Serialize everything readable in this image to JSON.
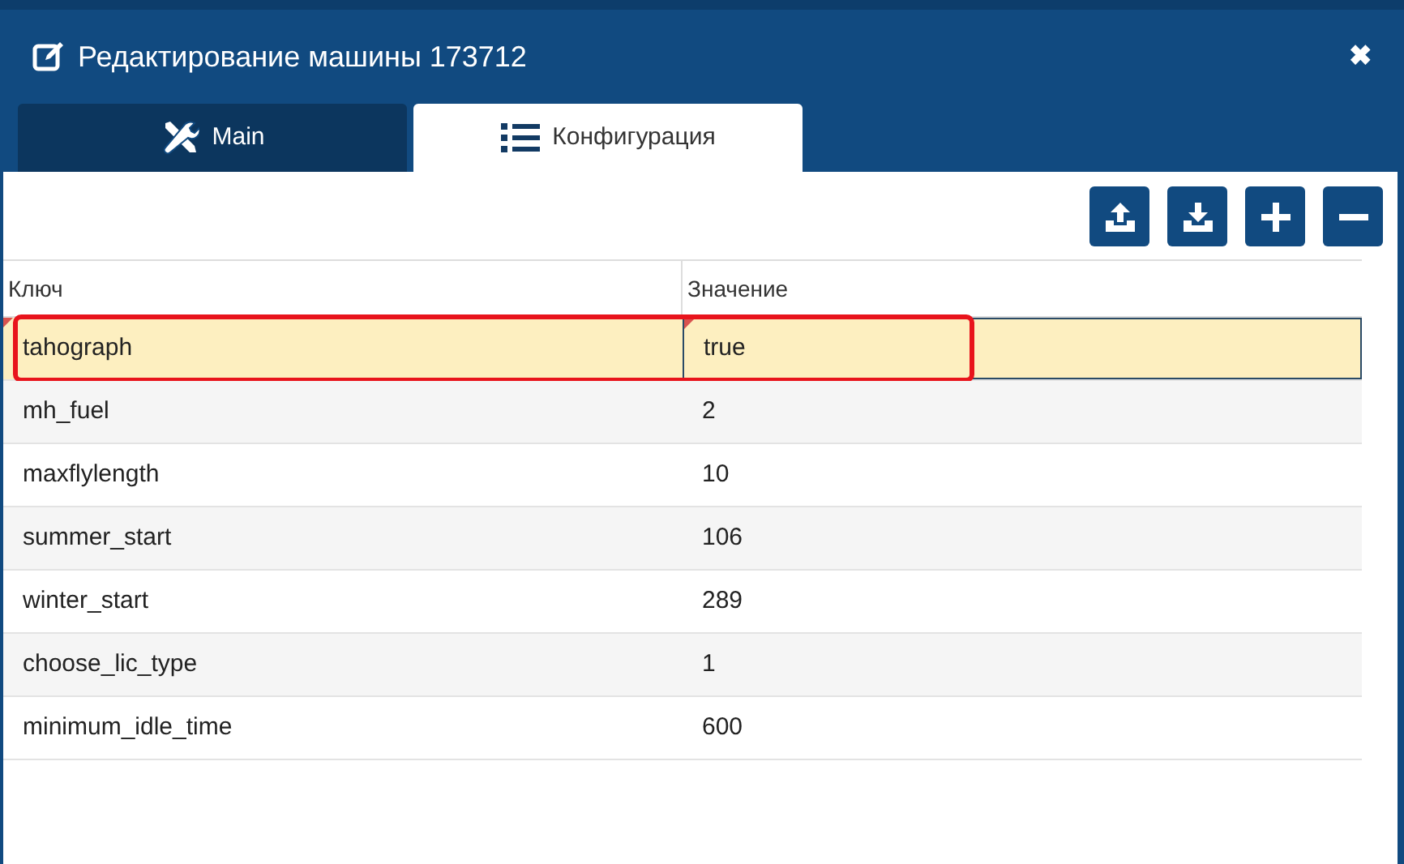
{
  "window": {
    "title": "Редактирование машины 173712",
    "close": "✖"
  },
  "tabs": [
    {
      "label": "Main",
      "selected": false
    },
    {
      "label": "Конфигурация",
      "selected": true
    }
  ],
  "table": {
    "columns": [
      "Ключ",
      "Значение"
    ],
    "rows": [
      {
        "key": "tahograph",
        "value": "true",
        "selected": true,
        "modified": true,
        "editing": true,
        "highlighted": true
      },
      {
        "key": "mh_fuel",
        "value": "2",
        "selected": false,
        "modified": false,
        "editing": false,
        "highlighted": false
      },
      {
        "key": "maxflylength",
        "value": "10",
        "selected": false,
        "modified": false,
        "editing": false,
        "highlighted": false
      },
      {
        "key": "summer_start",
        "value": "106",
        "selected": false,
        "modified": false,
        "editing": false,
        "highlighted": false
      },
      {
        "key": "winter_start",
        "value": "289",
        "selected": false,
        "modified": false,
        "editing": false,
        "highlighted": false
      },
      {
        "key": "choose_lic_type",
        "value": "1",
        "selected": false,
        "modified": false,
        "editing": false,
        "highlighted": false
      },
      {
        "key": "minimum_idle_time",
        "value": "600",
        "selected": false,
        "modified": false,
        "editing": false,
        "highlighted": false
      }
    ]
  }
}
